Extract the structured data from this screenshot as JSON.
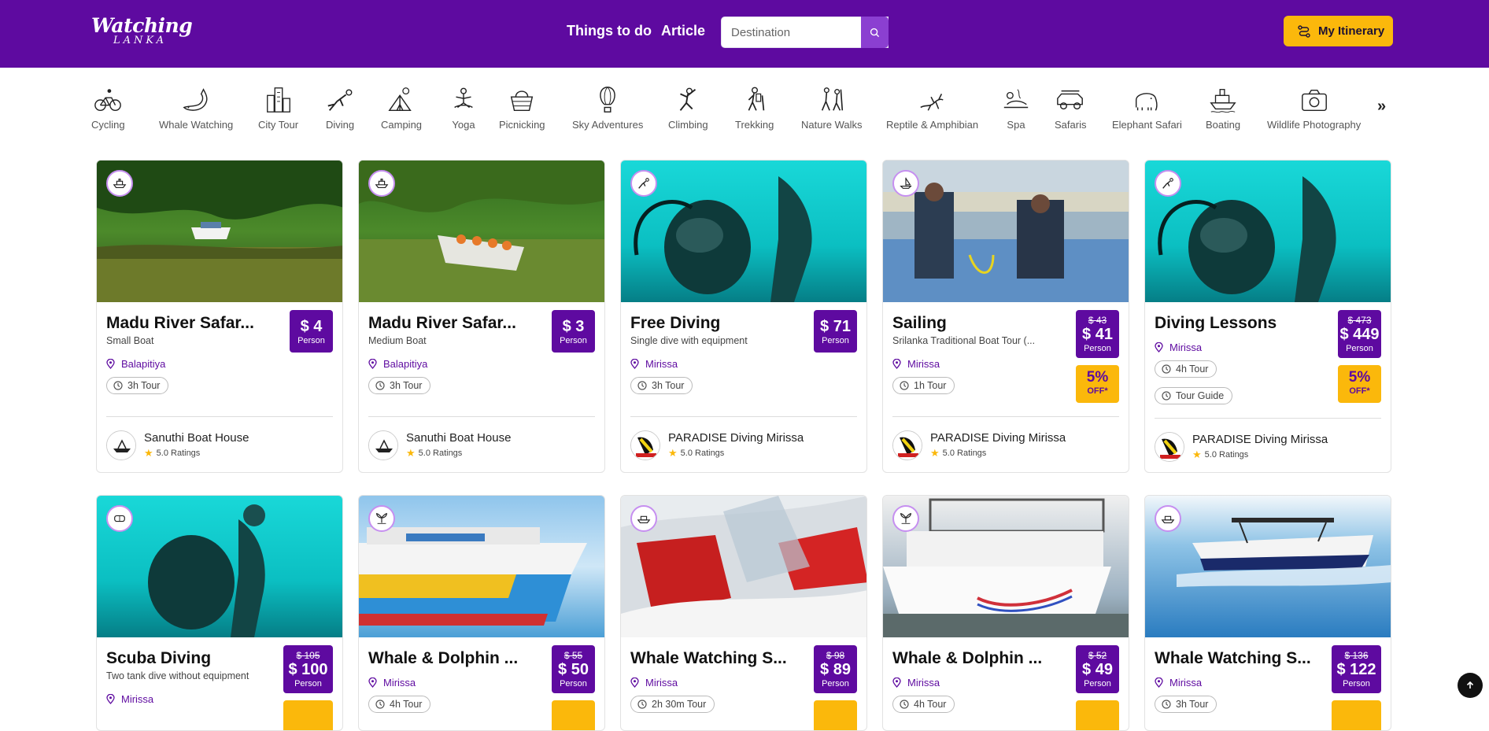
{
  "header": {
    "logo_main": "Watching",
    "logo_sub": "LANKA",
    "nav": [
      "Things to do",
      "Article"
    ],
    "search_placeholder": "Destination",
    "itinerary_label": "My Itinerary"
  },
  "categories": [
    "Cycling",
    "Whale Watching",
    "City Tour",
    "Diving",
    "Camping",
    "Yoga",
    "Picnicking",
    "Sky Adventures",
    "Climbing",
    "Trekking",
    "Nature Walks",
    "Reptile & Amphibian",
    "Spa",
    "Safaris",
    "Elephant Safari",
    "Boating",
    "Wildlife Photography"
  ],
  "more_label": "»",
  "cards": [
    {
      "title": "Madu River Safar...",
      "subtitle": "Small Boat",
      "location": "Balapitiya",
      "tags": [
        "3h Tour"
      ],
      "old_price": "",
      "price": "$ 4",
      "per": "Person",
      "discount": "",
      "discount_note": "",
      "provider": "Sanuthi Boat House",
      "rating": "5.0 Ratings",
      "badge_icon": "boat-icon",
      "image": "mangrove"
    },
    {
      "title": "Madu River Safar...",
      "subtitle": "Medium Boat",
      "location": "Balapitiya",
      "tags": [
        "3h Tour"
      ],
      "old_price": "",
      "price": "$ 3",
      "per": "Person",
      "discount": "",
      "discount_note": "",
      "provider": "Sanuthi Boat House",
      "rating": "5.0 Ratings",
      "badge_icon": "boat-icon",
      "image": "mangrove"
    },
    {
      "title": "Free Diving",
      "subtitle": "Single dive with equipment",
      "location": "Mirissa",
      "tags": [
        "3h Tour"
      ],
      "old_price": "",
      "price": "$ 71",
      "per": "Person",
      "discount": "",
      "discount_note": "",
      "provider": "PARADISE Diving Mirissa",
      "rating": "5.0 Ratings",
      "badge_icon": "diver-icon",
      "image": "underwater"
    },
    {
      "title": "Sailing",
      "subtitle": "Srilanka Traditional Boat Tour (...",
      "location": "Mirissa",
      "tags": [
        "1h Tour"
      ],
      "old_price": "$ 43",
      "price": "$ 41",
      "per": "Person",
      "discount": "5%",
      "discount_note": "OFF*",
      "provider": "PARADISE Diving Mirissa",
      "rating": "5.0 Ratings",
      "badge_icon": "sailboat-icon",
      "image": "boatdeck"
    },
    {
      "title": "Diving Lessons",
      "subtitle": "",
      "location": "Mirissa",
      "tags": [
        "4h Tour",
        "Tour Guide"
      ],
      "old_price": "$ 473",
      "price": "$ 449",
      "per": "Person",
      "discount": "5%",
      "discount_note": "OFF*",
      "provider": "PARADISE Diving Mirissa",
      "rating": "5.0 Ratings",
      "badge_icon": "diver-icon",
      "image": "underwater"
    },
    {
      "title": "Scuba Diving",
      "subtitle": "Two tank dive without equipment",
      "location": "Mirissa",
      "tags": [],
      "old_price": "$ 105",
      "price": "$ 100",
      "per": "Person",
      "discount": "",
      "discount_note": "",
      "provider": "",
      "rating": "",
      "badge_icon": "mask-icon",
      "image": "underwater"
    },
    {
      "title": "Whale & Dolphin ...",
      "subtitle": "",
      "location": "Mirissa",
      "tags": [
        "4h Tour"
      ],
      "old_price": "$ 55",
      "price": "$ 50",
      "per": "Person",
      "discount": "",
      "discount_note": "",
      "provider": "",
      "rating": "",
      "badge_icon": "whale-tail-icon",
      "image": "colorboat"
    },
    {
      "title": "Whale Watching S...",
      "subtitle": "",
      "location": "Mirissa",
      "tags": [
        "2h 30m Tour"
      ],
      "old_price": "$ 98",
      "price": "$ 89",
      "per": "Person",
      "discount": "",
      "discount_note": "",
      "provider": "",
      "rating": "",
      "badge_icon": "ship-icon",
      "image": "speedboat"
    },
    {
      "title": "Whale & Dolphin ...",
      "subtitle": "",
      "location": "Mirissa",
      "tags": [
        "4h Tour"
      ],
      "old_price": "$ 52",
      "price": "$ 49",
      "per": "Person",
      "discount": "",
      "discount_note": "",
      "provider": "",
      "rating": "",
      "badge_icon": "whale-tail-icon",
      "image": "catamaran"
    },
    {
      "title": "Whale Watching S...",
      "subtitle": "",
      "location": "Mirissa",
      "tags": [
        "3h Tour"
      ],
      "old_price": "$ 136",
      "price": "$ 122",
      "per": "Person",
      "discount": "",
      "discount_note": "",
      "provider": "",
      "rating": "",
      "badge_icon": "ship-icon",
      "image": "seaboat"
    }
  ],
  "colors": {
    "brand": "#5e0aa0",
    "accent": "#fbb80b",
    "badge_border": "#c68ff0"
  }
}
